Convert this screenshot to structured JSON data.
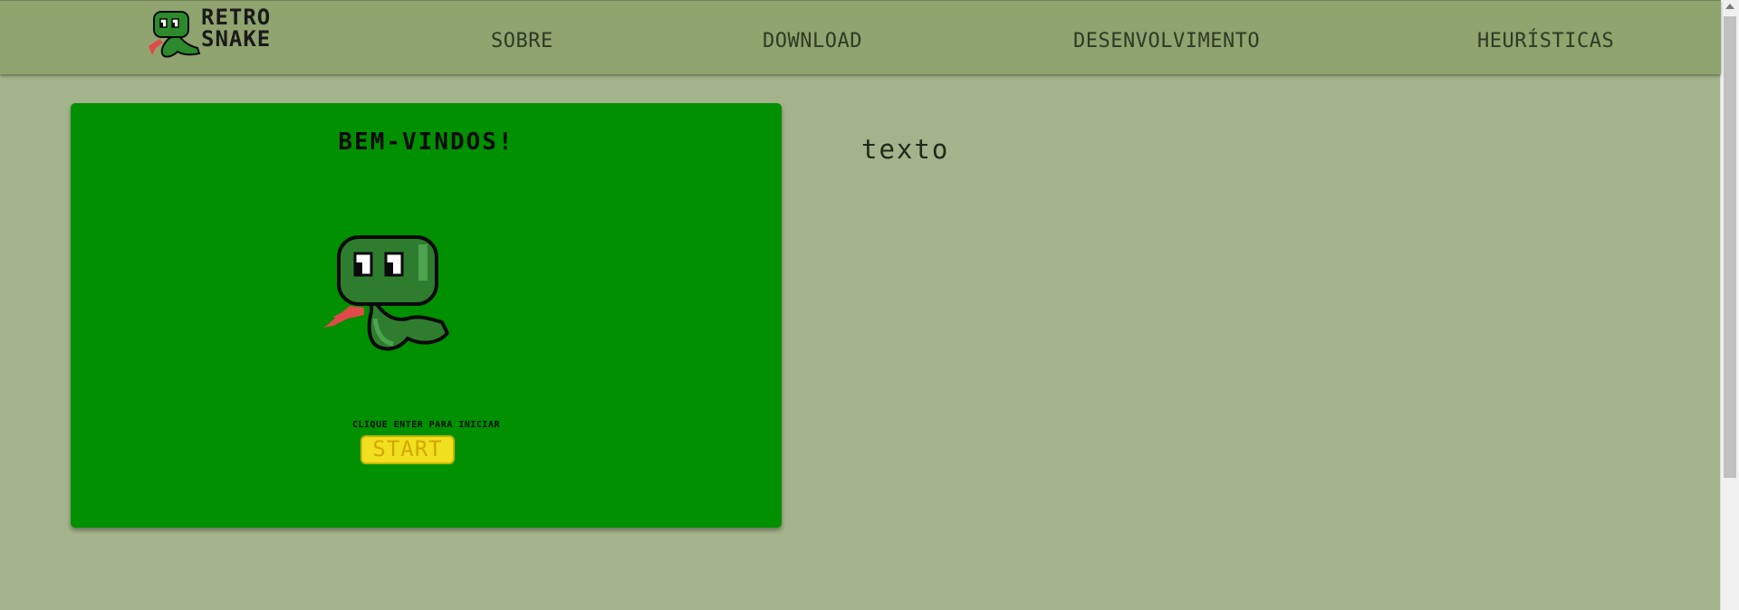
{
  "header": {
    "logo": {
      "line1": "RETRO",
      "line2": "SNAKE"
    },
    "nav": [
      {
        "label": "SOBRE"
      },
      {
        "label": "DOWNLOAD"
      },
      {
        "label": "DESENVOLVIMENTO"
      },
      {
        "label": "HEURÍSTICAS"
      }
    ]
  },
  "game": {
    "title": "BEM-VINDOS!",
    "hint": "CLIQUE ENTER PARA INICIAR",
    "start_label": "START"
  },
  "content": {
    "text": "texto"
  },
  "colors": {
    "page_bg": "#a3b38b",
    "header_bg": "#8fa46e",
    "game_bg": "#009000",
    "start_button": "#f0e020"
  }
}
